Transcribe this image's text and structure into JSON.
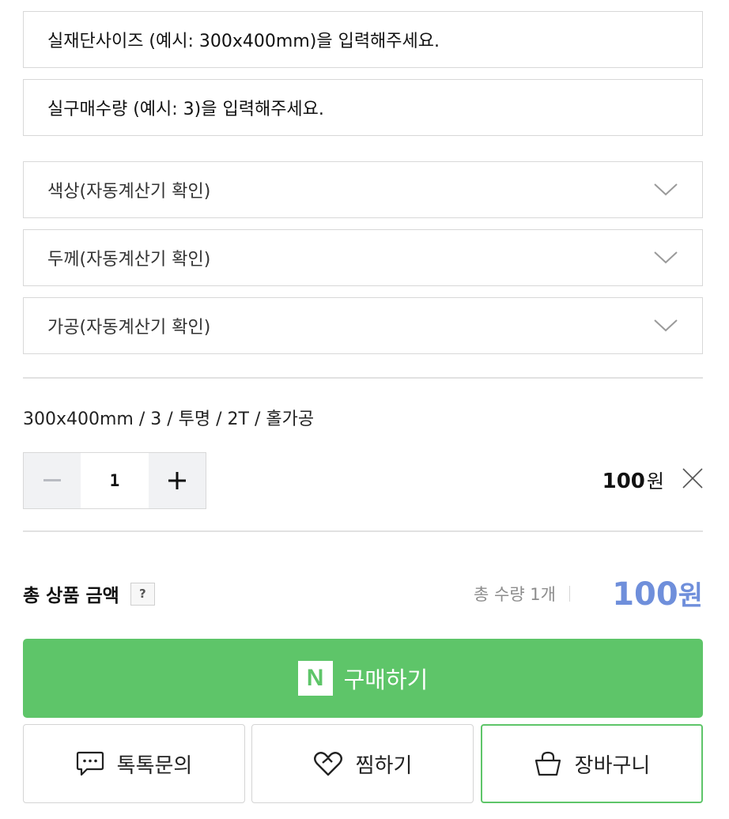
{
  "inputs": {
    "size_placeholder": "실재단사이즈 (예시: 300x400mm)을 입력해주세요.",
    "quantity_placeholder": "실구매수량 (예시: 3)을 입력해주세요."
  },
  "selects": {
    "color": "색상(자동계산기 확인)",
    "thickness": "두께(자동계산기 확인)",
    "processing": "가공(자동계산기 확인)"
  },
  "selected_option": {
    "summary": "300x400mm / 3 / 투명 / 2T / 홀가공",
    "quantity": "1",
    "price": "100",
    "price_unit": "원"
  },
  "total": {
    "label": "총 상품 금액",
    "help_label": "?",
    "quantity_text": "총 수량 1개",
    "price": "100",
    "price_unit": "원"
  },
  "actions": {
    "buy_logo": "N",
    "buy_label": "구매하기",
    "talk_label": "톡톡문의",
    "wish_label": "찜하기",
    "cart_label": "장바구니"
  },
  "icons": {
    "chevron": "chevron-down-icon",
    "minus": "minus-icon",
    "plus": "plus-icon",
    "remove": "close-icon",
    "talk": "chat-bubble-icon",
    "wish": "heart-icon",
    "cart": "shopping-bag-icon"
  },
  "colors": {
    "buy_green": "#5ec569",
    "price_blue": "#6f8fdb",
    "border_gray": "#d8d8d8"
  }
}
